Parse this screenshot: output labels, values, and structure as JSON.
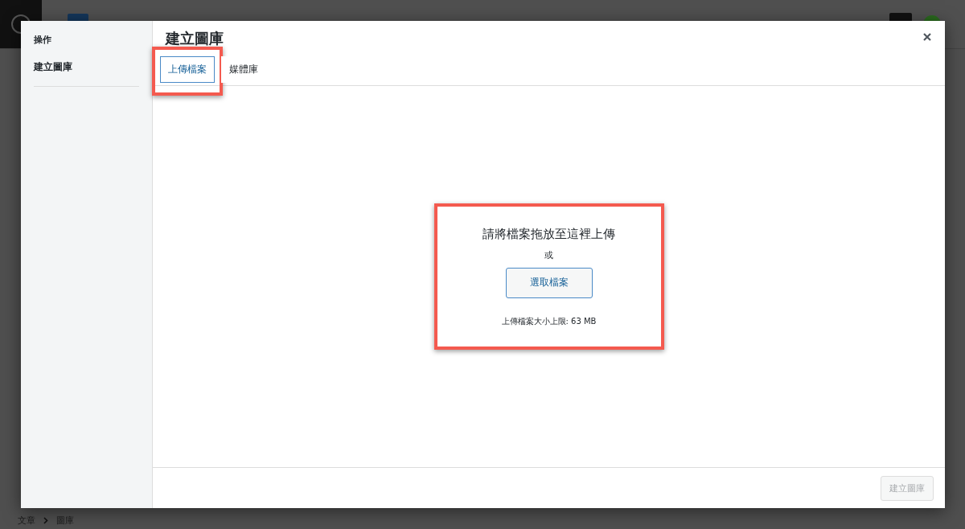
{
  "editor": {
    "breadcrumb": [
      "文章",
      "圖庫"
    ]
  },
  "modal": {
    "sidebar": {
      "heading": "操作",
      "items": [
        {
          "label": "建立圖庫"
        }
      ]
    },
    "title": "建立圖庫",
    "tabs": [
      {
        "label": "上傳檔案",
        "selected": true,
        "highlighted": true
      },
      {
        "label": "媒體庫",
        "selected": false,
        "highlighted": false
      }
    ],
    "dropzone": {
      "instructions": "請將檔案拖放至這裡上傳",
      "or": "或",
      "button": "選取檔案",
      "max_size": "上傳檔案大小上限: 63 MB",
      "highlighted": true
    },
    "footer": {
      "button": {
        "label": "建立圖庫",
        "disabled": true
      }
    }
  }
}
